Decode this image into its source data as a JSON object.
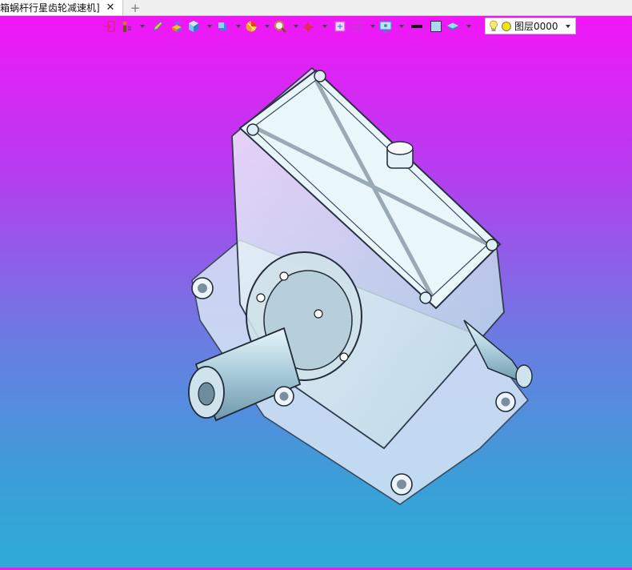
{
  "tab": {
    "title": "箱蜗杆行星齿轮减速机]",
    "close_symbol": "✕",
    "add_symbol": "+"
  },
  "toolbar": {
    "buttons": [
      {
        "name": "insert-icon",
        "color": "#e0218a"
      },
      {
        "name": "measure-icon",
        "color": "#d07a1c"
      },
      {
        "name": "pencil-icon",
        "color": "#3a7bd5"
      },
      {
        "name": "box-solid-icon",
        "color": "#f3c320"
      },
      {
        "name": "cube-icon",
        "color": "#2f8fe0"
      },
      {
        "name": "cube-view-icon",
        "color": "#2f8fe0"
      },
      {
        "name": "color-wheel-icon",
        "color": "#f3a31d"
      },
      {
        "name": "zoom-icon",
        "color": "#c98b2b"
      },
      {
        "name": "axis-icon",
        "color": "#e03040"
      },
      {
        "name": "frame-select-icon",
        "color": "#d24bd2"
      },
      {
        "name": "section-icon",
        "color": "#c23bd0"
      },
      {
        "name": "display-icon",
        "color": "#3a8fd0"
      },
      {
        "name": "line-style-icon",
        "color": "#111111"
      },
      {
        "name": "fill-color-icon",
        "color": "#a9d8f2"
      },
      {
        "name": "layer-stack-icon",
        "color": "#4ac0d8"
      }
    ],
    "layer": {
      "name": "图层0000",
      "bulb_color": "#f6e97a",
      "dot_color": "#f4e400"
    }
  }
}
